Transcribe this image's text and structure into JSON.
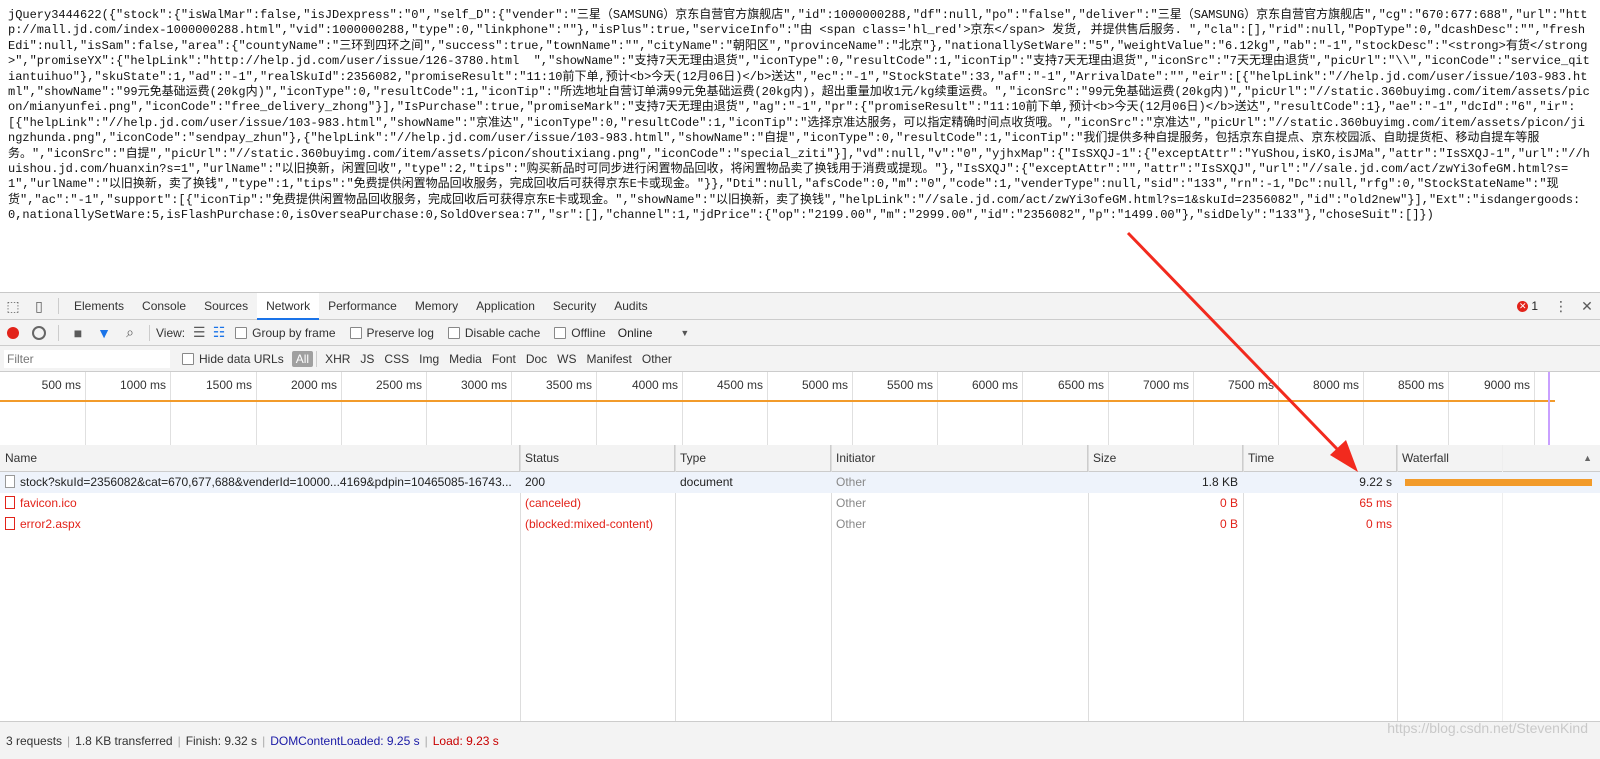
{
  "response": {
    "text": "jQuery3444622({\"stock\":{\"isWalMar\":false,\"isJDexpress\":\"0\",\"self_D\":{\"vender\":\"三星（SAMSUNG）京东自营官方旗舰店\",\"id\":1000000288,\"df\":null,\"po\":\"false\",\"deliver\":\"三星（SAMSUNG）京东自营官方旗舰店\",\"cg\":\"670:677:688\",\"url\":\"http://mall.jd.com/index-1000000288.html\",\"vid\":1000000288,\"type\":0,\"linkphone\":\"\"},\"isPlus\":true,\"serviceInfo\":\"由 <span class='hl_red'>京东</span> 发货, 并提供售后服务. \",\"cla\":[],\"rid\":null,\"PopType\":0,\"dcashDesc\":\"\",\"freshEdi\":null,\"isSam\":false,\"area\":{\"countyName\":\"三环到四环之间\",\"success\":true,\"townName\":\"\",\"cityName\":\"朝阳区\",\"provinceName\":\"北京\"},\"nationallySetWare\":\"5\",\"weightValue\":\"6.12kg\",\"ab\":\"-1\",\"stockDesc\":\"<strong>有货</strong>\",\"promiseYX\":{\"helpLink\":\"http://help.jd.com/user/issue/126-3780.html  \",\"showName\":\"支持7天无理由退货\",\"iconType\":0,\"resultCode\":1,\"iconTip\":\"支持7天无理由退货\",\"iconSrc\":\"7天无理由退货\",\"picUrl\":\"\\\\\",\"iconCode\":\"service_qitiantuihuo\"},\"skuState\":1,\"ad\":\"-1\",\"realSkuId\":2356082,\"promiseResult\":\"11:10前下单,预计<b>今天(12月06日)</b>送达\",\"ec\":\"-1\",\"StockState\":33,\"af\":\"-1\",\"ArrivalDate\":\"\",\"eir\":[{\"helpLink\":\"//help.jd.com/user/issue/103-983.html\",\"showName\":\"99元免基础运费(20kg内)\",\"iconType\":0,\"resultCode\":1,\"iconTip\":\"所选地址自营订单满99元免基础运费(20kg内)，超出重量加收1元/kg续重运费。\",\"iconSrc\":\"99元免基础运费(20kg内)\",\"picUrl\":\"//static.360buyimg.com/item/assets/picon/mianyunfei.png\",\"iconCode\":\"free_delivery_zhong\"}],\"IsPurchase\":true,\"promiseMark\":\"支持7天无理由退货\",\"ag\":\"-1\",\"pr\":{\"promiseResult\":\"11:10前下单,预计<b>今天(12月06日)</b>送达\",\"resultCode\":1},\"ae\":\"-1\",\"dcId\":\"6\",\"ir\":[{\"helpLink\":\"//help.jd.com/user/issue/103-983.html\",\"showName\":\"京准达\",\"iconType\":0,\"resultCode\":1,\"iconTip\":\"选择京准达服务，可以指定精确时间点收货哦。\",\"iconSrc\":\"京准达\",\"picUrl\":\"//static.360buyimg.com/item/assets/picon/jingzhunda.png\",\"iconCode\":\"sendpay_zhun\"},{\"helpLink\":\"//help.jd.com/user/issue/103-983.html\",\"showName\":\"自提\",\"iconType\":0,\"resultCode\":1,\"iconTip\":\"我们提供多种自提服务，包括京东自提点、京东校园派、自助提货柜、移动自提车等服务。\",\"iconSrc\":\"自提\",\"picUrl\":\"//static.360buyimg.com/item/assets/picon/shoutixiang.png\",\"iconCode\":\"special_ziti\"}],\"vd\":null,\"v\":\"0\",\"yjhxMap\":{\"IsSXQJ-1\":{\"exceptAttr\":\"YuShou,isKO,isJMa\",\"attr\":\"IsSXQJ-1\",\"url\":\"//huishou.jd.com/huanxin?s=1\",\"urlName\":\"以旧换新，闲置回收\",\"type\":2,\"tips\":\"购买新品时可同步进行闲置物品回收，将闲置物品卖了换钱用于消费或提现。\"},\"IsSXQJ\":{\"exceptAttr\":\"\",\"attr\":\"IsSXQJ\",\"url\":\"//sale.jd.com/act/zwYi3ofeGM.html?s=1\",\"urlName\":\"以旧换新，卖了换钱\",\"type\":1,\"tips\":\"免费提供闲置物品回收服务，完成回收后可获得京东E卡或现金。\"}},\"Dti\":null,\"afsCode\":0,\"m\":\"0\",\"code\":1,\"venderType\":null,\"sid\":\"133\",\"rn\":-1,\"Dc\":null,\"rfg\":0,\"StockStateName\":\"现货\",\"ac\":\"-1\",\"support\":[{\"iconTip\":\"免费提供闲置物品回收服务，完成回收后可获得京东E卡或现金。\",\"showName\":\"以旧换新，卖了换钱\",\"helpLink\":\"//sale.jd.com/act/zwYi3ofeGM.html?s=1&skuId=2356082\",\"id\":\"old2new\"}],\"Ext\":\"isdangergoods:0,nationallySetWare:5,isFlashPurchase:0,isOverseaPurchase:0,SoldOversea:7\",\"sr\":[],\"channel\":1,\"jdPrice\":{\"op\":\"2199.00\",\"m\":\"2999.00\",\"id\":\"2356082\",\"p\":\"1499.00\"},\"sidDely\":\"133\"},\"choseSuit\":[]})"
  },
  "devtools": {
    "tabs": [
      "Elements",
      "Console",
      "Sources",
      "Network",
      "Performance",
      "Memory",
      "Application",
      "Security",
      "Audits"
    ],
    "active_tab": "Network",
    "error_count": "1",
    "toolbar": {
      "view_label": "View:",
      "group_by_frame": "Group by frame",
      "preserve_log": "Preserve log",
      "disable_cache": "Disable cache",
      "offline": "Offline",
      "throttle": "Online"
    },
    "filter": {
      "placeholder": "Filter",
      "hide_data_urls": "Hide data URLs",
      "types": [
        "All",
        "XHR",
        "JS",
        "CSS",
        "Img",
        "Media",
        "Font",
        "Doc",
        "WS",
        "Manifest",
        "Other"
      ]
    },
    "timeline": {
      "ticks": [
        "500 ms",
        "1000 ms",
        "1500 ms",
        "2000 ms",
        "2500 ms",
        "3000 ms",
        "3500 ms",
        "4000 ms",
        "4500 ms",
        "5000 ms",
        "5500 ms",
        "6000 ms",
        "6500 ms",
        "7000 ms",
        "7500 ms",
        "8000 ms",
        "8500 ms",
        "9000 ms",
        "9500"
      ]
    },
    "columns": [
      "Name",
      "Status",
      "Type",
      "Initiator",
      "Size",
      "Time",
      "Waterfall"
    ],
    "requests": [
      {
        "name": "stock?skuId=2356082&cat=670,677,688&venderId=10000...4169&pdpin=10465085-16743...",
        "status": "200",
        "type": "document",
        "initiator": "Other",
        "size": "1.8 KB",
        "time": "9.22 s",
        "error": false
      },
      {
        "name": "favicon.ico",
        "status": "(canceled)",
        "type": "",
        "initiator": "Other",
        "size": "0 B",
        "time": "65 ms",
        "error": true
      },
      {
        "name": "error2.aspx",
        "status": "(blocked:mixed-content)",
        "type": "",
        "initiator": "Other",
        "size": "0 B",
        "time": "0 ms",
        "error": true
      }
    ],
    "status_bar": {
      "requests": "3 requests",
      "transferred": "1.8 KB transferred",
      "finish": "Finish: 9.32 s",
      "dom_content_loaded": "DOMContentLoaded: 9.25 s",
      "load": "Load: 9.23 s"
    },
    "watermark": "https://blog.csdn.net/StevenKind"
  },
  "colors": {
    "accent": "#1a73e8",
    "error": "#e2231a",
    "waterfall": "#f29b2b",
    "annotation_arrow": "#f22a1e"
  }
}
